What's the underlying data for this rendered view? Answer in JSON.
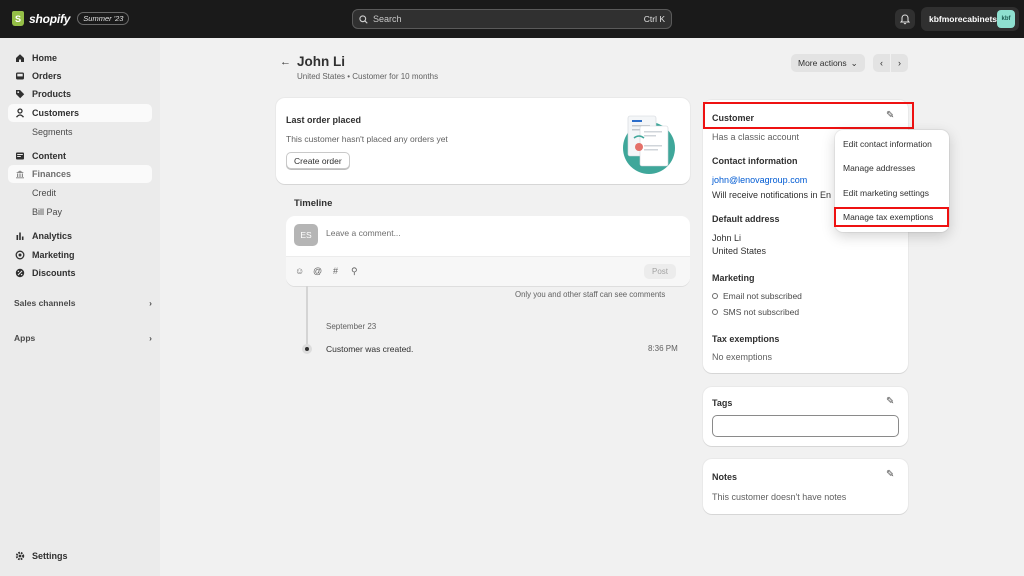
{
  "topbar": {
    "brand": "shopify",
    "edition_badge": "Summer '23",
    "search_placeholder": "Search",
    "search_shortcut": "Ctrl K",
    "store_name": "kbfmorecabinets",
    "store_initials": "kbf"
  },
  "sidebar": {
    "items": [
      {
        "label": "Home",
        "icon": "home-icon"
      },
      {
        "label": "Orders",
        "icon": "inbox-icon"
      },
      {
        "label": "Products",
        "icon": "tag-icon"
      },
      {
        "label": "Customers",
        "icon": "person-icon"
      },
      {
        "label": "Segments"
      },
      {
        "label": "Content",
        "icon": "content-icon"
      },
      {
        "label": "Finances",
        "icon": "bank-icon"
      },
      {
        "label": "Credit"
      },
      {
        "label": "Bill Pay"
      },
      {
        "label": "Analytics",
        "icon": "bar-chart-icon"
      },
      {
        "label": "Marketing",
        "icon": "target-icon"
      },
      {
        "label": "Discounts",
        "icon": "discount-icon"
      }
    ],
    "sales_channels": "Sales channels",
    "apps": "Apps",
    "settings": "Settings"
  },
  "page": {
    "title": "John Li",
    "subtitle": "United States • Customer for 10 months",
    "more_actions": "More actions"
  },
  "last_order": {
    "title": "Last order placed",
    "text": "This customer hasn't placed any orders yet",
    "button": "Create order"
  },
  "timeline": {
    "title": "Timeline",
    "avatar_initials": "ES",
    "comment_placeholder": "Leave a comment...",
    "post_label": "Post",
    "staff_note": "Only you and other staff can see comments",
    "date": "September 23",
    "event": "Customer was created.",
    "event_time": "8:36 PM"
  },
  "customer_card": {
    "title": "Customer",
    "account_type": "Has a classic account",
    "contact_heading": "Contact information",
    "email": "john@lenovagroup.com",
    "notifications": "Will receive notifications in En",
    "address_heading": "Default address",
    "address_name": "John Li",
    "address_country": "United States",
    "marketing_heading": "Marketing",
    "email_marketing": "Email not subscribed",
    "sms_marketing": "SMS not subscribed",
    "tax_heading": "Tax exemptions",
    "tax_value": "No exemptions"
  },
  "dropdown": {
    "items": [
      "Edit contact information",
      "Manage addresses",
      "Edit marketing settings",
      "Manage tax exemptions"
    ]
  },
  "tags_card": {
    "title": "Tags",
    "value": ""
  },
  "notes_card": {
    "title": "Notes",
    "text": "This customer doesn't have notes"
  },
  "colors": {
    "highlight": "#ee1111",
    "topbar": "#1a1a1a",
    "link": "#005bd3",
    "illustration_teal": "#3fa79a"
  }
}
